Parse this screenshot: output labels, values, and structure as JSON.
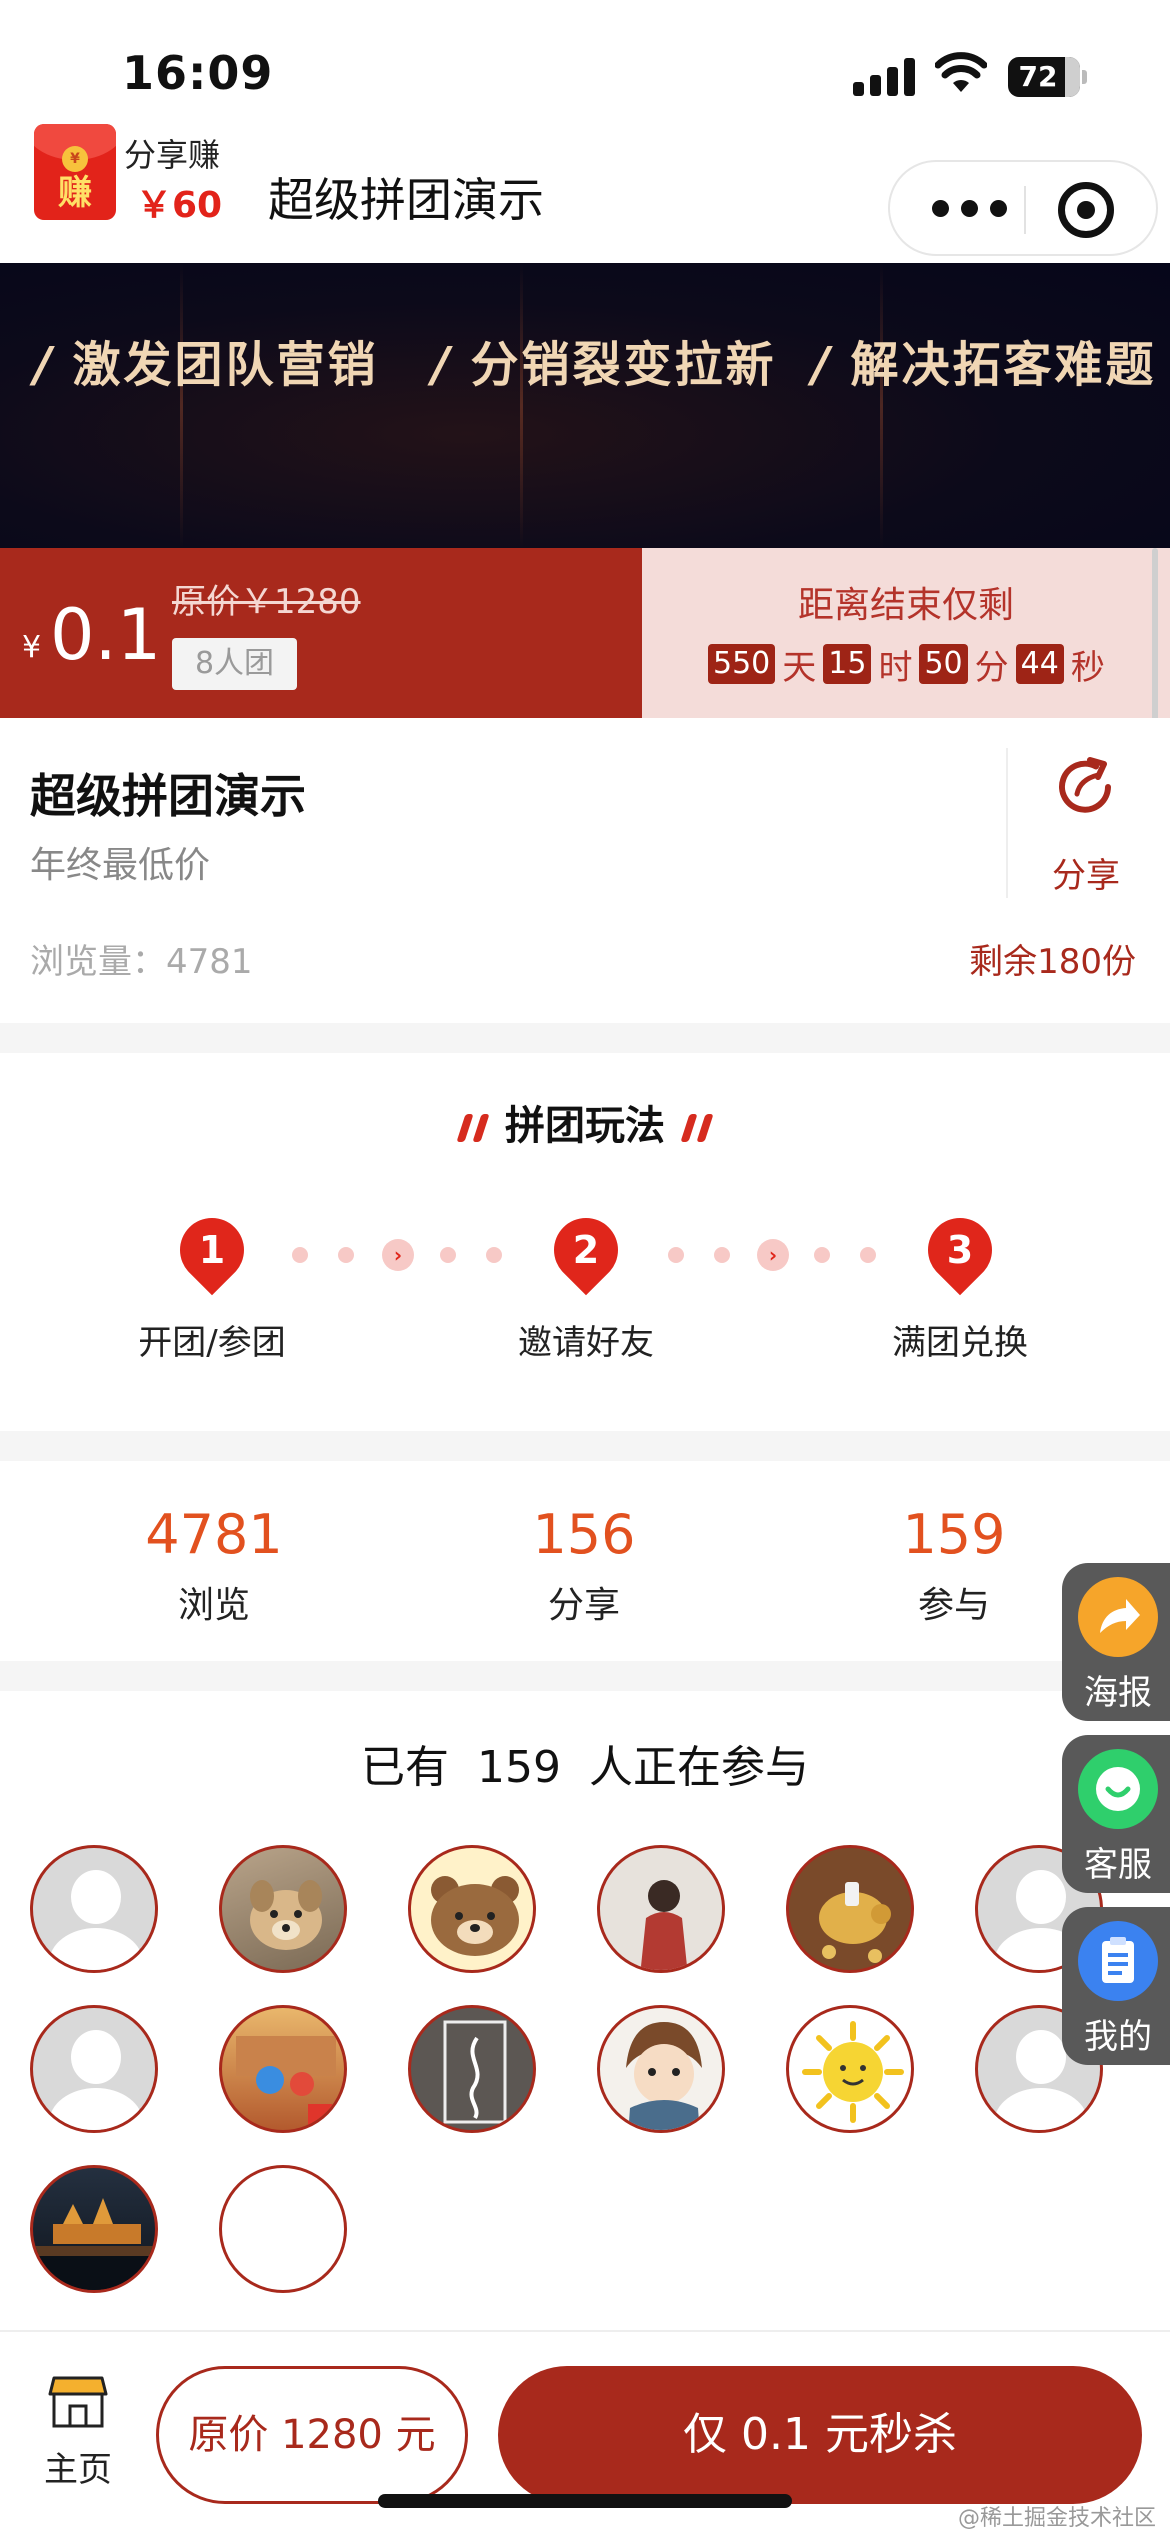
{
  "status_bar": {
    "time": "16:09",
    "battery": "72"
  },
  "nav": {
    "share_earn_label": "分享赚",
    "share_earn_amount": "￥60",
    "redpack_word": "赚",
    "redpack_coin": "¥",
    "title": "超级拼团演示"
  },
  "banner": {
    "slogans": [
      "激发团队营销",
      "分销裂变拉新",
      "解决拓客难题"
    ],
    "slash": "/"
  },
  "price": {
    "currency": "¥",
    "current": "0.1",
    "original": "原价￥1280",
    "group_size": "8人团"
  },
  "countdown": {
    "title": "距离结束仅剩",
    "days": "550",
    "days_unit": "天",
    "hours": "15",
    "hours_unit": "时",
    "minutes": "50",
    "minutes_unit": "分",
    "seconds": "44",
    "seconds_unit": "秒"
  },
  "product": {
    "title": "超级拼团演示",
    "subtitle": "年终最低价",
    "views": "浏览量：4781",
    "stock": "剩余180份",
    "share_label": "分享"
  },
  "rules": {
    "title": "拼团玩法",
    "steps": [
      {
        "num": "1",
        "label": "开团/参团"
      },
      {
        "num": "2",
        "label": "邀请好友"
      },
      {
        "num": "3",
        "label": "满团兑换"
      }
    ]
  },
  "stats": [
    {
      "value": "4781",
      "label": "浏览"
    },
    {
      "value": "156",
      "label": "分享"
    },
    {
      "value": "159",
      "label": "参与"
    }
  ],
  "participants": {
    "title": "已有  159  人正在参与",
    "avatars": [
      "default",
      "dog",
      "bear",
      "girl",
      "piggy-bank",
      "default",
      "default",
      "cartoon",
      "music",
      "anime-boy",
      "sun",
      "default",
      "night-city",
      "empty"
    ]
  },
  "side_buttons": [
    {
      "label": "海报",
      "icon": "share-arrow-icon",
      "color": "#f6a52a"
    },
    {
      "label": "客服",
      "icon": "chat-icon",
      "color": "#2fcf6c"
    },
    {
      "label": "我的",
      "icon": "clipboard-icon",
      "color": "#3b82f0"
    }
  ],
  "bottom": {
    "home_label": "主页",
    "original_button": "原价 1280 元",
    "buy_button": "仅 0.1 元秒杀"
  },
  "watermark": "@稀土掘金技术社区",
  "colors": {
    "brand": "#a8291c",
    "accent_orange": "#e2511f",
    "countdown_bg": "#f4dcd9"
  }
}
